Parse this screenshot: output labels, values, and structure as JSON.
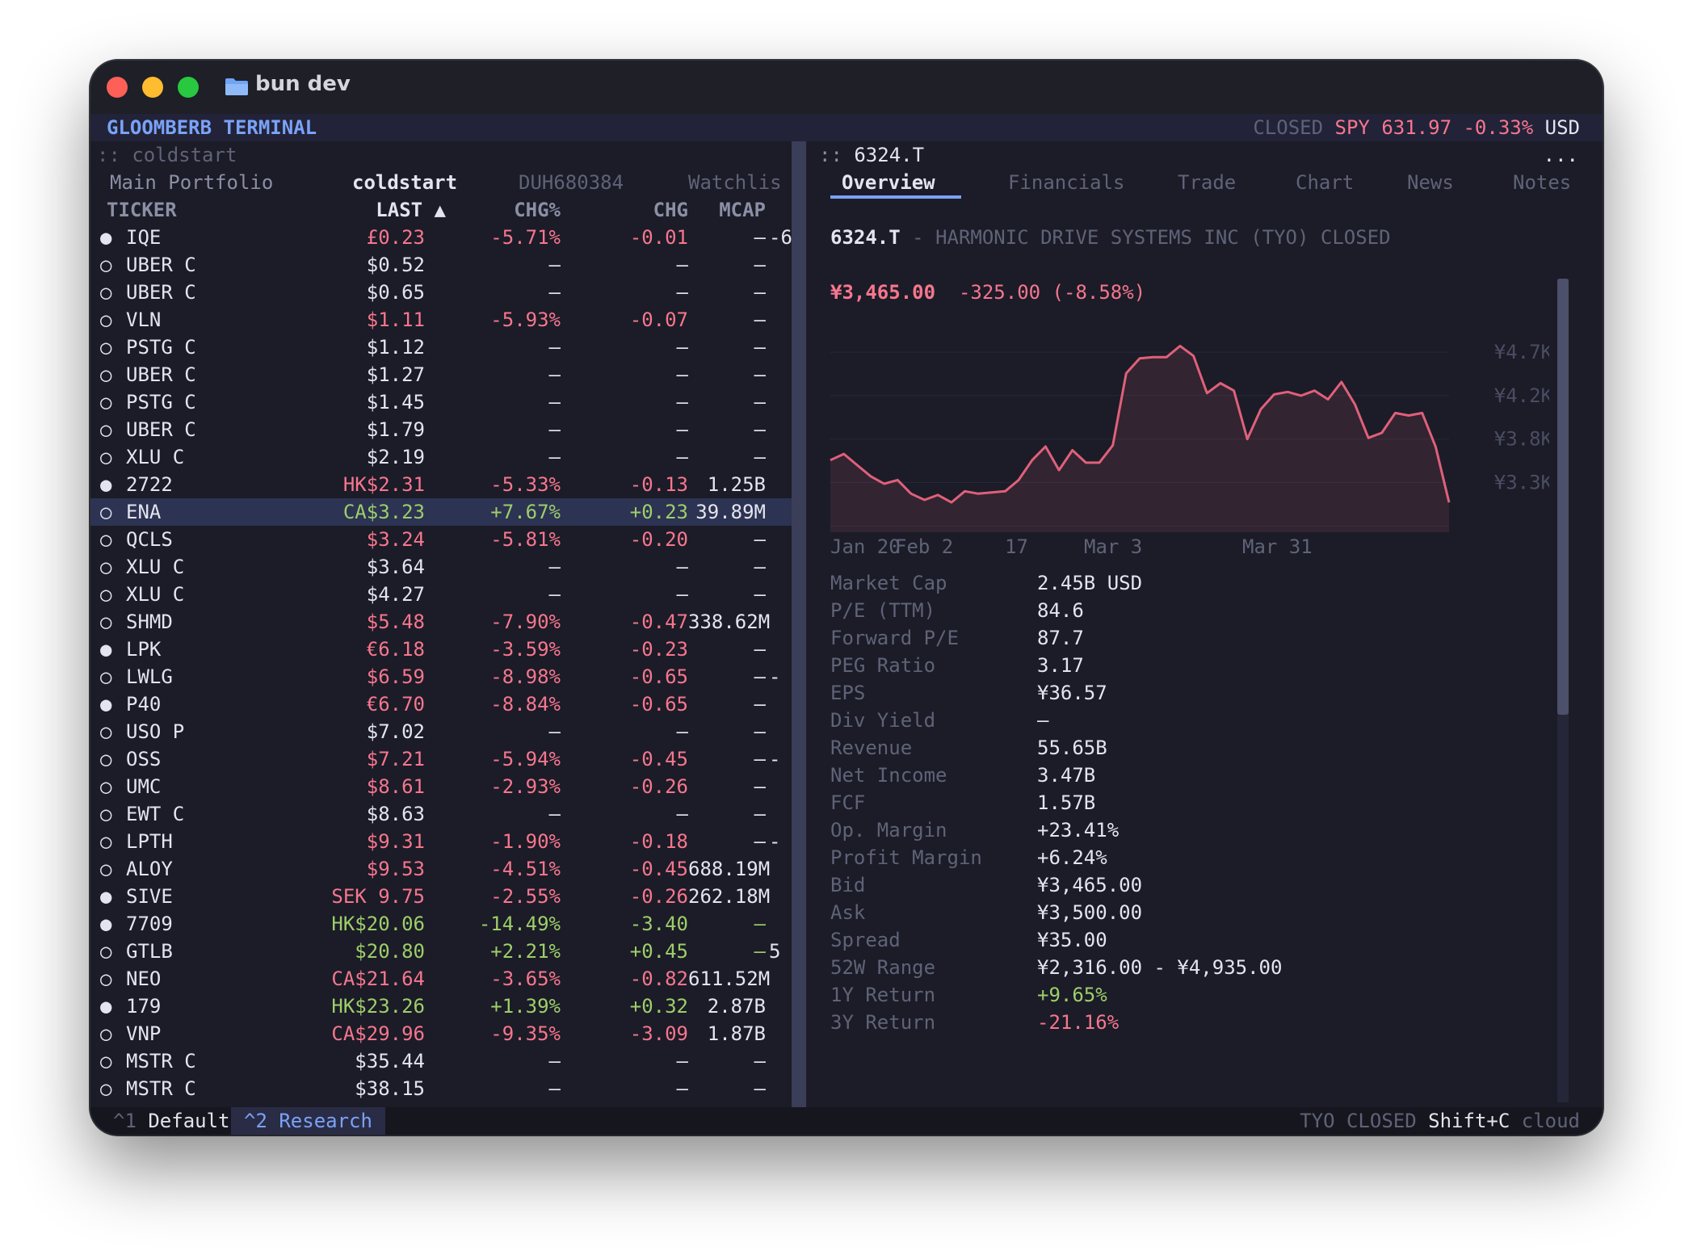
{
  "window": {
    "title": "bun dev"
  },
  "header": {
    "app_name": "GLOOMBERB TERMINAL",
    "market_state": "CLOSED",
    "symbol": "SPY",
    "price": "631.97",
    "change": "-0.33%",
    "currency": "USD"
  },
  "left": {
    "path_prefix": "::",
    "path": "coldstart",
    "tabs": [
      "Main Portfolio",
      "coldstart",
      "DUH680384",
      "Watchlis"
    ],
    "active_tab": 1,
    "columns": {
      "ticker": "TICKER",
      "last": "LAST ▲",
      "chgp": "CHG%",
      "chg": "CHG",
      "mcap": "MCAP"
    },
    "rows": [
      {
        "dot": "●",
        "ticker": "IQE",
        "last": "£0.23",
        "chgp": "-5.71%",
        "chg": "-0.01",
        "mcap": "—",
        "extra": "-6",
        "tone": "red"
      },
      {
        "dot": "○",
        "ticker": "UBER C",
        "last": "$0.52",
        "chgp": "—",
        "chg": "—",
        "mcap": "—",
        "extra": "",
        "tone": "flat"
      },
      {
        "dot": "○",
        "ticker": "UBER C",
        "last": "$0.65",
        "chgp": "—",
        "chg": "—",
        "mcap": "—",
        "extra": "",
        "tone": "flat"
      },
      {
        "dot": "○",
        "ticker": "VLN",
        "last": "$1.11",
        "chgp": "-5.93%",
        "chg": "-0.07",
        "mcap": "—",
        "extra": "",
        "tone": "red"
      },
      {
        "dot": "○",
        "ticker": "PSTG C",
        "last": "$1.12",
        "chgp": "—",
        "chg": "—",
        "mcap": "—",
        "extra": "",
        "tone": "flat"
      },
      {
        "dot": "○",
        "ticker": "UBER C",
        "last": "$1.27",
        "chgp": "—",
        "chg": "—",
        "mcap": "—",
        "extra": "",
        "tone": "flat"
      },
      {
        "dot": "○",
        "ticker": "PSTG C",
        "last": "$1.45",
        "chgp": "—",
        "chg": "—",
        "mcap": "—",
        "extra": "",
        "tone": "flat"
      },
      {
        "dot": "○",
        "ticker": "UBER C",
        "last": "$1.79",
        "chgp": "—",
        "chg": "—",
        "mcap": "—",
        "extra": "",
        "tone": "flat"
      },
      {
        "dot": "○",
        "ticker": "XLU C",
        "last": "$2.19",
        "chgp": "—",
        "chg": "—",
        "mcap": "—",
        "extra": "",
        "tone": "flat"
      },
      {
        "dot": "●",
        "ticker": "2722",
        "last": "HK$2.31",
        "chgp": "-5.33%",
        "chg": "-0.13",
        "mcap": "1.25B",
        "extra": "",
        "tone": "red"
      },
      {
        "dot": "○",
        "ticker": "ENA",
        "last": "CA$3.23",
        "chgp": "+7.67%",
        "chg": "+0.23",
        "mcap": "39.89M",
        "extra": "",
        "tone": "green",
        "selected": true
      },
      {
        "dot": "○",
        "ticker": "QCLS",
        "last": "$3.24",
        "chgp": "-5.81%",
        "chg": "-0.20",
        "mcap": "—",
        "extra": "",
        "tone": "red"
      },
      {
        "dot": "○",
        "ticker": "XLU C",
        "last": "$3.64",
        "chgp": "—",
        "chg": "—",
        "mcap": "—",
        "extra": "",
        "tone": "flat"
      },
      {
        "dot": "○",
        "ticker": "XLU C",
        "last": "$4.27",
        "chgp": "—",
        "chg": "—",
        "mcap": "—",
        "extra": "",
        "tone": "flat"
      },
      {
        "dot": "○",
        "ticker": "SHMD",
        "last": "$5.48",
        "chgp": "-7.90%",
        "chg": "-0.47",
        "mcap": "338.62M",
        "extra": "",
        "tone": "red"
      },
      {
        "dot": "●",
        "ticker": "LPK",
        "last": "€6.18",
        "chgp": "-3.59%",
        "chg": "-0.23",
        "mcap": "—",
        "extra": "",
        "tone": "red"
      },
      {
        "dot": "○",
        "ticker": "LWLG",
        "last": "$6.59",
        "chgp": "-8.98%",
        "chg": "-0.65",
        "mcap": "—",
        "extra": "-",
        "tone": "red"
      },
      {
        "dot": "●",
        "ticker": "P40",
        "last": "€6.70",
        "chgp": "-8.84%",
        "chg": "-0.65",
        "mcap": "—",
        "extra": "",
        "tone": "red"
      },
      {
        "dot": "○",
        "ticker": "USO P",
        "last": "$7.02",
        "chgp": "—",
        "chg": "—",
        "mcap": "—",
        "extra": "",
        "tone": "flat"
      },
      {
        "dot": "○",
        "ticker": "OSS",
        "last": "$7.21",
        "chgp": "-5.94%",
        "chg": "-0.45",
        "mcap": "—",
        "extra": "-",
        "tone": "red"
      },
      {
        "dot": "○",
        "ticker": "UMC",
        "last": "$8.61",
        "chgp": "-2.93%",
        "chg": "-0.26",
        "mcap": "—",
        "extra": "",
        "tone": "red"
      },
      {
        "dot": "○",
        "ticker": "EWT C",
        "last": "$8.63",
        "chgp": "—",
        "chg": "—",
        "mcap": "—",
        "extra": "",
        "tone": "flat"
      },
      {
        "dot": "○",
        "ticker": "LPTH",
        "last": "$9.31",
        "chgp": "-1.90%",
        "chg": "-0.18",
        "mcap": "—",
        "extra": "-",
        "tone": "red"
      },
      {
        "dot": "○",
        "ticker": "ALOY",
        "last": "$9.53",
        "chgp": "-4.51%",
        "chg": "-0.45",
        "mcap": "688.19M",
        "extra": "",
        "tone": "red"
      },
      {
        "dot": "●",
        "ticker": "SIVE",
        "last": "SEK 9.75",
        "chgp": "-2.55%",
        "chg": "-0.26",
        "mcap": "262.18M",
        "extra": "",
        "tone": "red"
      },
      {
        "dot": "●",
        "ticker": "7709",
        "last": "HK$20.06",
        "chgp": "-14.49%",
        "chg": "-3.40",
        "mcap": "—",
        "extra": "",
        "tone": "green"
      },
      {
        "dot": "○",
        "ticker": "GTLB",
        "last": "$20.80",
        "chgp": "+2.21%",
        "chg": "+0.45",
        "mcap": "—",
        "extra": "5",
        "tone": "green"
      },
      {
        "dot": "○",
        "ticker": "NEO",
        "last": "CA$21.64",
        "chgp": "-3.65%",
        "chg": "-0.82",
        "mcap": "611.52M",
        "extra": "",
        "tone": "red"
      },
      {
        "dot": "●",
        "ticker": "179",
        "last": "HK$23.26",
        "chgp": "+1.39%",
        "chg": "+0.32",
        "mcap": "2.87B",
        "extra": "",
        "tone": "green"
      },
      {
        "dot": "○",
        "ticker": "VNP",
        "last": "CA$29.96",
        "chgp": "-9.35%",
        "chg": "-3.09",
        "mcap": "1.87B",
        "extra": "",
        "tone": "red"
      },
      {
        "dot": "○",
        "ticker": "MSTR C",
        "last": "$35.44",
        "chgp": "—",
        "chg": "—",
        "mcap": "—",
        "extra": "",
        "tone": "flat"
      },
      {
        "dot": "○",
        "ticker": "MSTR C",
        "last": "$38.15",
        "chgp": "—",
        "chg": "—",
        "mcap": "—",
        "extra": "",
        "tone": "flat"
      }
    ]
  },
  "right": {
    "path_prefix": "::",
    "symbol": "6324.T",
    "more": "...",
    "tabs": [
      "Overview",
      "Financials",
      "Trade",
      "Chart",
      "News",
      "Notes"
    ],
    "active_tab": 0,
    "sep": "-",
    "company": "HARMONIC DRIVE SYSTEMS INC (TYO) CLOSED",
    "price": "¥3,465.00",
    "change": "-325.00 (-8.58%)",
    "stats": [
      {
        "label": "Market Cap",
        "value": "2.45B USD",
        "tone": "white"
      },
      {
        "label": "P/E (TTM)",
        "value": "84.6",
        "tone": "white"
      },
      {
        "label": "Forward P/E",
        "value": "87.7",
        "tone": "white"
      },
      {
        "label": "PEG Ratio",
        "value": "3.17",
        "tone": "white"
      },
      {
        "label": "EPS",
        "value": "¥36.57",
        "tone": "white"
      },
      {
        "label": "Div Yield",
        "value": "—",
        "tone": "white"
      },
      {
        "label": "Revenue",
        "value": "55.65B",
        "tone": "white"
      },
      {
        "label": "Net Income",
        "value": "3.47B",
        "tone": "white"
      },
      {
        "label": "FCF",
        "value": "1.57B",
        "tone": "white"
      },
      {
        "label": "Op. Margin",
        "value": "+23.41%",
        "tone": "white"
      },
      {
        "label": "Profit Margin",
        "value": "+6.24%",
        "tone": "white"
      },
      {
        "label": "Bid",
        "value": "¥3,465.00",
        "tone": "white"
      },
      {
        "label": "Ask",
        "value": "¥3,500.00",
        "tone": "white"
      },
      {
        "label": "Spread",
        "value": "¥35.00",
        "tone": "white"
      },
      {
        "label": "52W Range",
        "value": "¥2,316.00 - ¥4,935.00",
        "tone": "white"
      },
      {
        "label": "1Y Return",
        "value": "+9.65%",
        "tone": "green"
      },
      {
        "label": "3Y Return",
        "value": "-21.16%",
        "tone": "red"
      }
    ]
  },
  "chart_data": {
    "type": "area",
    "x_tick_labels": [
      "Jan 20",
      "Feb 2",
      "17",
      "Mar 3",
      "Mar 31"
    ],
    "y_tick_labels": [
      "¥4.7K",
      "¥4.2K",
      "¥3.8K",
      "¥3.3K"
    ],
    "ylim": [
      3200,
      4800
    ],
    "values": [
      3780,
      3830,
      3740,
      3650,
      3590,
      3620,
      3510,
      3460,
      3500,
      3440,
      3530,
      3510,
      3520,
      3530,
      3620,
      3780,
      3890,
      3700,
      3860,
      3760,
      3760,
      3900,
      4480,
      4600,
      4610,
      4610,
      4700,
      4620,
      4320,
      4400,
      4340,
      3950,
      4190,
      4310,
      4330,
      4300,
      4340,
      4270,
      4410,
      4230,
      3960,
      4000,
      4160,
      4140,
      4160,
      3890,
      3440
    ],
    "color": "#e0607a"
  },
  "statusbar": {
    "layout1_key": "^1",
    "layout1": "Default",
    "layout2_key": "^2",
    "layout2": "Research",
    "exchange": "TYO CLOSED",
    "shortcut": "Shift+C",
    "mode": "cloud"
  }
}
